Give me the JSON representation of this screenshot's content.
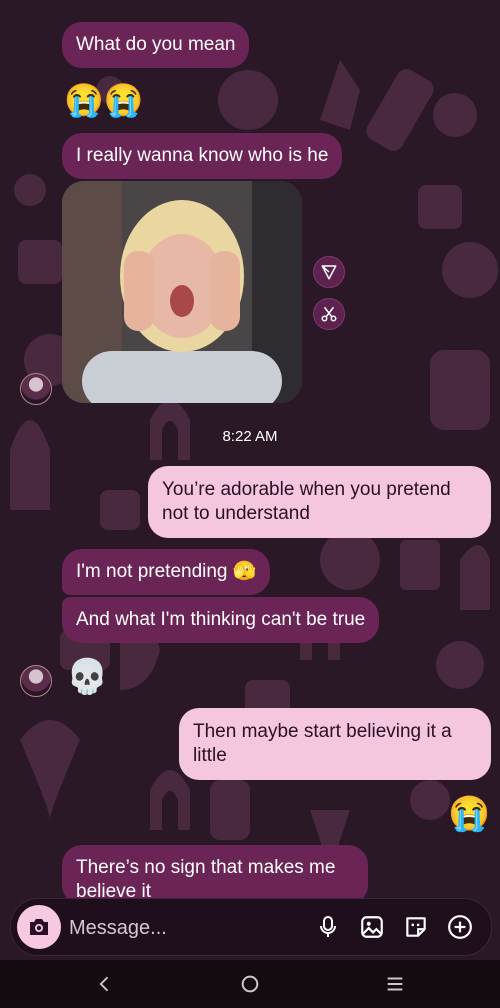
{
  "messages": {
    "m1": "What do you mean",
    "m2_emoji": "😭😭",
    "m3": "I really wanna know who is he",
    "timestamp": "8:22 AM",
    "m4": "You’re adorable when you pretend not to understand",
    "m5": "I'm not pretending 🫣",
    "m6": "And what I'm thinking can't be true",
    "m7_emoji": "💀",
    "m8": "Then maybe start believing it a little",
    "m9_emoji": "😭",
    "m10": "There’s no sign that makes me believe it"
  },
  "composer": {
    "placeholder": "Message...",
    "camera_icon": "camera-icon",
    "mic_icon": "microphone-icon",
    "gallery_icon": "gallery-icon",
    "sticker_icon": "sticker-icon",
    "add_icon": "plus-icon"
  },
  "photo_actions": {
    "share_icon": "share-icon",
    "remix_icon": "remix-icon"
  },
  "navbar": {
    "back_icon": "back-icon",
    "home_icon": "home-icon",
    "recents_icon": "recents-icon"
  },
  "colors": {
    "incoming_bubble": "#6b2456",
    "outgoing_bubble": "#f5c7df",
    "background": "#2a1826"
  }
}
